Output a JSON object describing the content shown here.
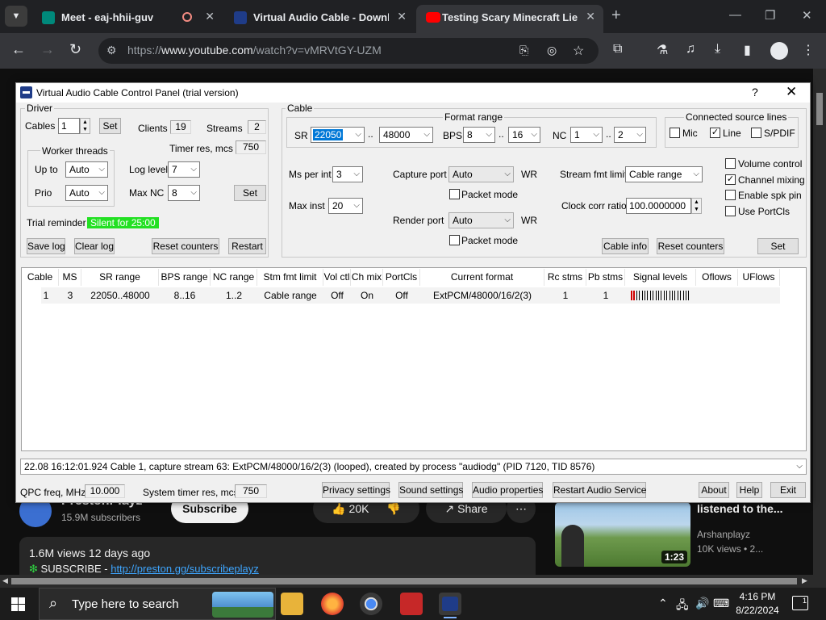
{
  "browser": {
    "tabs": [
      {
        "title": "Meet - eaj-hhii-guv",
        "active": false
      },
      {
        "title": "Virtual Audio Cable - Downloa",
        "active": false
      },
      {
        "title": "Testing Scary Minecraft Lies To",
        "active": true
      }
    ],
    "url_domain": "www.youtube.com",
    "url_prefix": "https://",
    "url_path": "/watch?v=vMRVtGY-UZM"
  },
  "youtube": {
    "channel_name": "PrestonPlayz",
    "subscribers": "15.9M subscribers",
    "subscribe_label": "Subscribe",
    "likes": "20K",
    "share_label": "Share",
    "more_label": "⋯",
    "views_line": "1.6M views  12 days ago",
    "subscribe_line_prefix": "SUBSCRIBE - ",
    "subscribe_link": "http://preston.gg/subscribeplayz",
    "related": {
      "title": "listened to the...",
      "channel": "Arshanplayz",
      "views": "10K views  •  2...",
      "duration": "1:23"
    }
  },
  "taskbar": {
    "search_placeholder": "Type here to search",
    "time": "4:16 PM",
    "date": "8/22/2024",
    "notifications": "1"
  },
  "dialog": {
    "title": "Virtual Audio Cable Control Panel (trial version)",
    "driver": {
      "group_label": "Driver",
      "cables_label": "Cables",
      "cables_value": "1",
      "set_label": "Set",
      "clients_label": "Clients",
      "clients_value": "19",
      "streams_label": "Streams",
      "streams_value": "2",
      "worker_label": "Worker threads",
      "upto_label": "Up to",
      "upto_value": "Auto",
      "prio_label": "Prio",
      "prio_value": "Auto",
      "timer_label": "Timer res, mcs",
      "timer_value": "750",
      "loglevel_label": "Log level",
      "loglevel_value": "7",
      "maxnc_label": "Max NC",
      "maxnc_value": "8",
      "set2_label": "Set",
      "trial_label": "Trial reminder",
      "trial_status": "Silent for 25:00",
      "save_log": "Save log",
      "clear_log": "Clear log",
      "reset_counters": "Reset counters",
      "restart": "Restart"
    },
    "cable": {
      "group_label": "Cable",
      "sr_label": "SR",
      "sr_min": "22050",
      "sr_max": "48000",
      "range_sep": "..",
      "format_range_label": "Format range",
      "bps_label": "BPS",
      "bps_min": "8",
      "bps_max": "16",
      "nc_label": "NC",
      "nc_min": "1",
      "nc_max": "2",
      "connected_label": "Connected source lines",
      "mic_label": "Mic",
      "line_label": "Line",
      "spdif_label": "S/PDIF",
      "ms_per_int_label": "Ms per int",
      "ms_per_int_value": "3",
      "max_inst_label": "Max inst",
      "max_inst_value": "20",
      "capture_port_label": "Capture port",
      "capture_port_value": "Auto",
      "wr_label": "WR",
      "packet_mode_label": "Packet mode",
      "render_port_label": "Render port",
      "render_port_value": "Auto",
      "stream_fmt_label": "Stream fmt limit",
      "stream_fmt_value": "Cable range",
      "clock_corr_label": "Clock corr ratio",
      "clock_corr_value": "100.0000000",
      "volume_control_label": "Volume control",
      "channel_mixing_label": "Channel mixing",
      "enable_spk_label": "Enable spk pin",
      "use_portcls_label": "Use PortCls",
      "cable_info": "Cable info",
      "reset_counters": "Reset counters",
      "set_label": "Set"
    },
    "checks": {
      "mic": false,
      "line": true,
      "spdif": false,
      "capture_packet": false,
      "render_packet": false,
      "volume_control": false,
      "channel_mixing": true,
      "enable_spk_pin": false,
      "use_portcls": false
    },
    "table": {
      "headers": [
        "Cable",
        "MS",
        "SR range",
        "BPS range",
        "NC range",
        "Stm fmt limit",
        "Vol ctl",
        "Ch mix",
        "PortCls",
        "Current format",
        "Rc stms",
        "Pb stms",
        "Signal levels",
        "Oflows",
        "UFlows"
      ],
      "rows": [
        [
          "1",
          "3",
          "22050..48000",
          "8..16",
          "1..2",
          "Cable range",
          "Off",
          "On",
          "Off",
          "ExtPCM/48000/16/2(3)",
          "1",
          "1",
          "",
          "",
          ""
        ]
      ]
    },
    "status_line": "22.08    16:12:01.924  Cable 1, capture stream 63: ExtPCM/48000/16/2(3) (looped), created by process \"audiodg\" (PID 7120, TID 8576)",
    "bottom": {
      "qpc_label": "QPC freq, MHz",
      "qpc_value": "10.000",
      "systimer_label": "System timer res, mcs",
      "systimer_value": "750",
      "privacy_settings": "Privacy settings",
      "sound_settings": "Sound settings",
      "audio_properties": "Audio properties",
      "restart_audio": "Restart Audio Service",
      "about": "About",
      "help": "Help",
      "exit": "Exit"
    }
  }
}
